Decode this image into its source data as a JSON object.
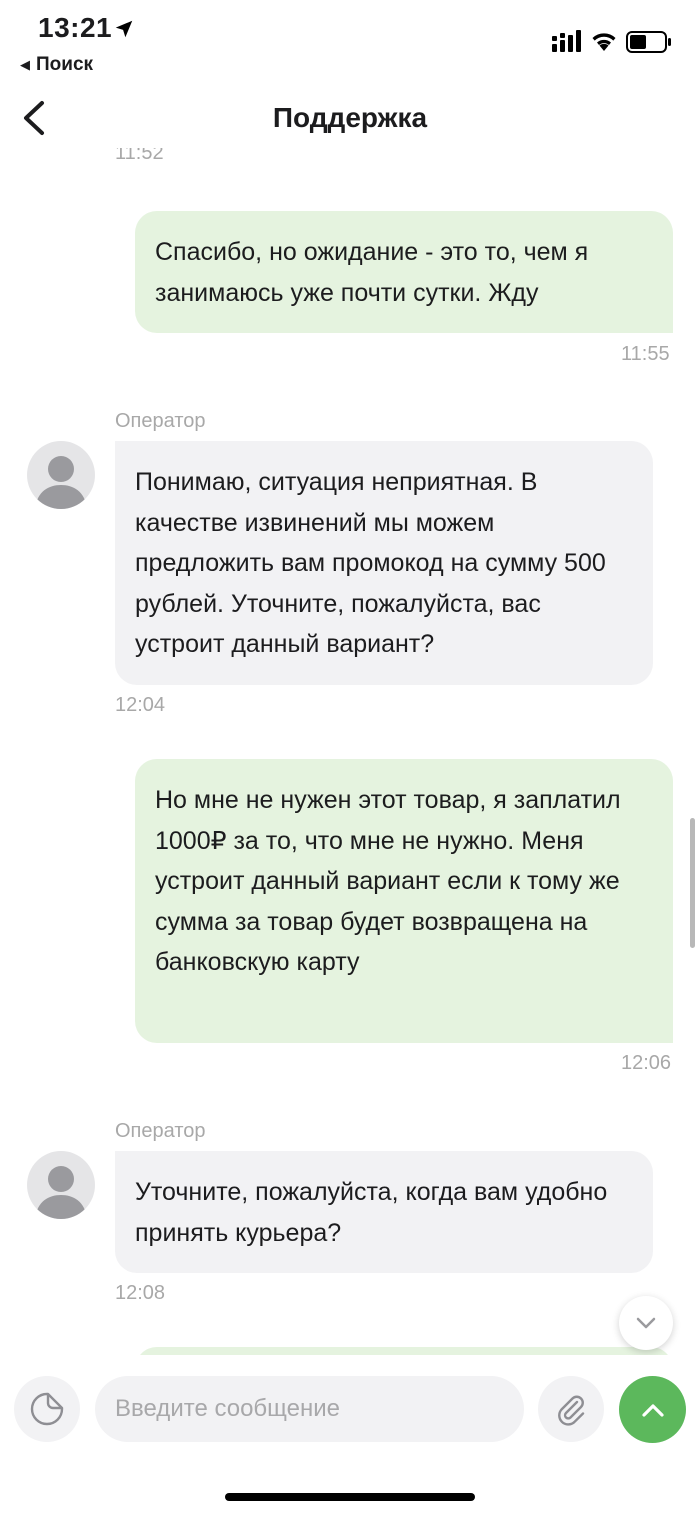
{
  "status_bar": {
    "time": "13:21",
    "back_app_label": "Поиск",
    "icons": [
      "location-arrow-icon",
      "cellular-signal-icon",
      "wifi-icon",
      "battery-icon"
    ]
  },
  "nav": {
    "title": "Поддержка",
    "back_icon": "chevron-left-icon"
  },
  "messages": [
    {
      "from": "user",
      "text": "",
      "time": "11:52"
    },
    {
      "from": "user",
      "text": "Спасибо, но ожидание - это то, чем я занимаюсь уже почти сутки. Жду",
      "time": "11:55"
    },
    {
      "from": "operator",
      "sender": "Оператор",
      "text": "Понимаю, ситуация неприятная. В качестве извинений мы можем предложить вам промокод на сумму 500 рублей. Уточните, пожалуйста, вас устроит данный вариант?",
      "time": "12:04"
    },
    {
      "from": "user",
      "text": "Но мне не нужен этот товар, я заплатил 1000₽ за то, что мне не нужно. Меня устроит данный вариант если к тому же сумма за товар будет возвращена на банковскую карту",
      "time": "12:06"
    },
    {
      "from": "operator",
      "sender": "Оператор",
      "text": "Уточните, пожалуйста, когда вам удобно принять курьера?",
      "time": "12:08"
    }
  ],
  "input": {
    "placeholder": "Введите сообщение",
    "value": ""
  },
  "colors": {
    "user_bubble": "#e5f3df",
    "operator_bubble": "#f2f2f4",
    "send_button": "#5cb85c",
    "timestamp": "#a8a8a8"
  }
}
